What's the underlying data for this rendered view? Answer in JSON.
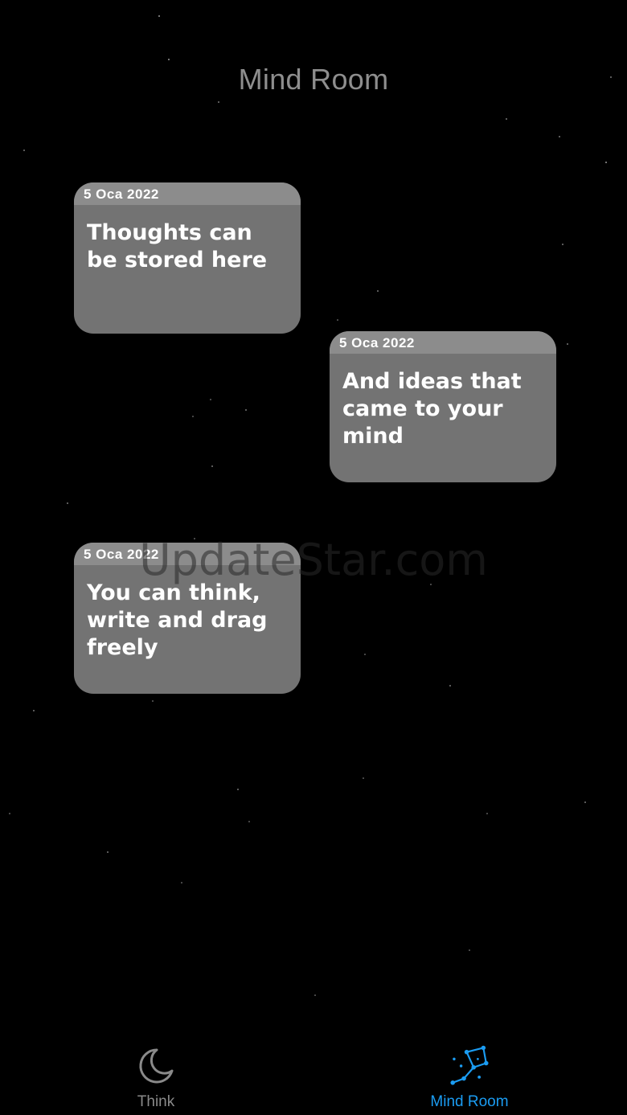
{
  "header": {
    "title": "Mind Room"
  },
  "notes": [
    {
      "date": "5 Oca 2022",
      "text": "Thoughts can be stored here"
    },
    {
      "date": "5 Oca 2022",
      "text": "And ideas that came to your mind"
    },
    {
      "date": "5 Oca 2022",
      "text": "You can think, write and drag freely"
    }
  ],
  "watermark": "UpdateStar.com",
  "tabbar": {
    "tabs": [
      {
        "label": "Think",
        "icon": "moon-icon",
        "selected": false
      },
      {
        "label": "Mind Room",
        "icon": "constellation-icon",
        "selected": true
      }
    ]
  },
  "colors": {
    "background": "#000000",
    "note": "#737373",
    "note_header": "#8c8c8c",
    "accent": "#1b9cf2",
    "inactive": "#8a8a8a"
  }
}
